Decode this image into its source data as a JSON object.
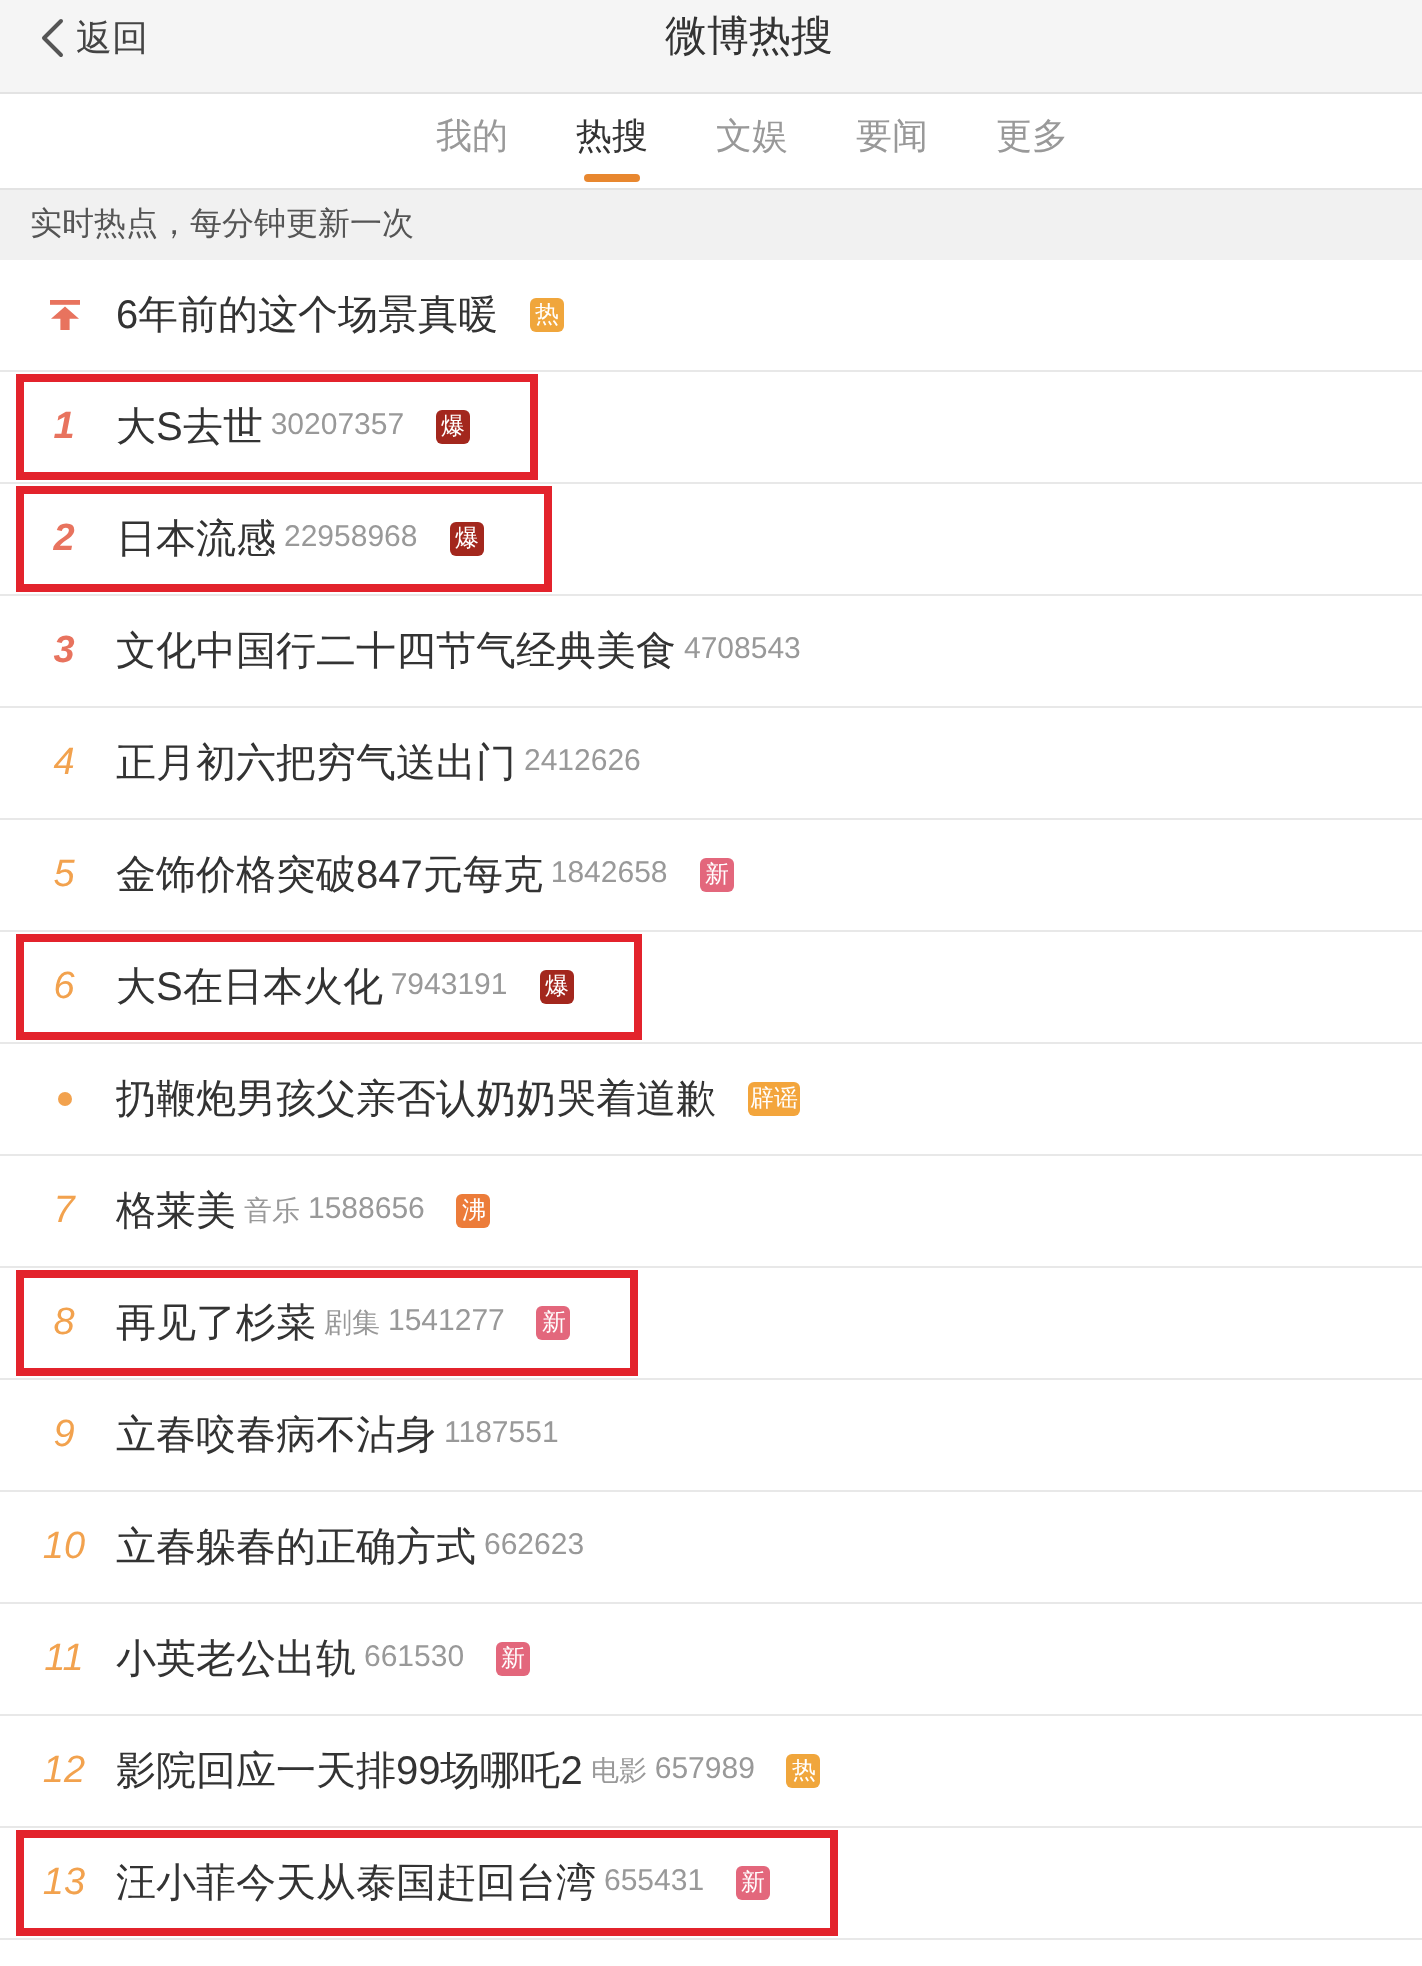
{
  "header": {
    "back_label": "返回",
    "title": "微博热搜"
  },
  "tabs": [
    {
      "label": "我的",
      "selected": false
    },
    {
      "label": "热搜",
      "selected": true
    },
    {
      "label": "文娱",
      "selected": false
    },
    {
      "label": "要闻",
      "selected": false
    },
    {
      "label": "更多",
      "selected": false
    }
  ],
  "notice": "实时热点，每分钟更新一次",
  "rows": [
    {
      "kind": "pinned",
      "color": "#e8735e",
      "title": "6年前的这个场景真暖",
      "badge": {
        "text": "热",
        "color": "#f0a63c"
      },
      "highlighted": false
    },
    {
      "kind": "top",
      "rank": "1",
      "color": "#e8735e",
      "title": "大S去世",
      "count": "30207357",
      "badge": {
        "text": "爆",
        "color": "#a3271d"
      },
      "highlighted": true
    },
    {
      "kind": "top",
      "rank": "2",
      "color": "#e8735e",
      "title": "日本流感",
      "count": "22958968",
      "badge": {
        "text": "爆",
        "color": "#a3271d"
      },
      "highlighted": true
    },
    {
      "kind": "top",
      "rank": "3",
      "color": "#e8735e",
      "title": "文化中国行二十四节气经典美食",
      "count": "4708543",
      "highlighted": false
    },
    {
      "kind": "ranked",
      "rank": "4",
      "color": "#f2a24e",
      "title": "正月初六把穷气送出门",
      "count": "2412626",
      "highlighted": false
    },
    {
      "kind": "ranked",
      "rank": "5",
      "color": "#f2a24e",
      "title": "金饰价格突破847元每克",
      "count": "1842658",
      "badge": {
        "text": "新",
        "color": "#e3677c"
      },
      "highlighted": false
    },
    {
      "kind": "ranked",
      "rank": "6",
      "color": "#f2a24e",
      "title": "大S在日本火化",
      "count": "7943191",
      "badge": {
        "text": "爆",
        "color": "#a3271d"
      },
      "highlighted": true
    },
    {
      "kind": "bullet",
      "color": "#f2a24e",
      "title": "扔鞭炮男孩父亲否认奶奶哭着道歉",
      "badge": {
        "text": "辟谣",
        "color": "#f3a53c"
      },
      "highlighted": false
    },
    {
      "kind": "ranked",
      "rank": "7",
      "color": "#f2a24e",
      "title": "格莱美",
      "category": "音乐",
      "count": "1588656",
      "badge": {
        "text": "沸",
        "color": "#ec7c3a"
      },
      "highlighted": false
    },
    {
      "kind": "ranked",
      "rank": "8",
      "color": "#f2a24e",
      "title": "再见了杉菜",
      "category": "剧集",
      "count": "1541277",
      "badge": {
        "text": "新",
        "color": "#e3677c"
      },
      "highlighted": true
    },
    {
      "kind": "ranked",
      "rank": "9",
      "color": "#f2a24e",
      "title": "立春咬春病不沾身",
      "count": "1187551",
      "highlighted": false
    },
    {
      "kind": "ranked",
      "rank": "10",
      "color": "#f2a24e",
      "title": "立春躲春的正确方式",
      "count": "662623",
      "highlighted": false
    },
    {
      "kind": "ranked",
      "rank": "11",
      "color": "#f2a24e",
      "title": "小英老公出轨",
      "count": "661530",
      "badge": {
        "text": "新",
        "color": "#e3677c"
      },
      "highlighted": false
    },
    {
      "kind": "ranked",
      "rank": "12",
      "color": "#f2a24e",
      "title": "影院回应一天排99场哪吒2",
      "category": "电影",
      "count": "657989",
      "badge": {
        "text": "热",
        "color": "#f0a63c"
      },
      "highlighted": false
    },
    {
      "kind": "ranked",
      "rank": "13",
      "color": "#f2a24e",
      "title": "汪小菲今天从泰国赶回台湾",
      "count": "655431",
      "badge": {
        "text": "新",
        "color": "#e3677c"
      },
      "highlighted": true
    }
  ]
}
